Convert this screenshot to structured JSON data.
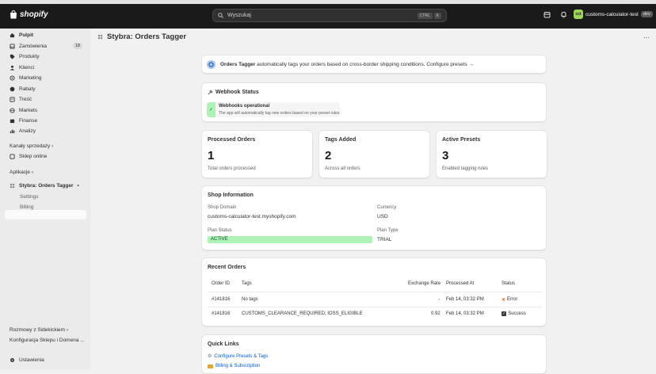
{
  "topbar": {
    "logo_text": "shopify",
    "search_placeholder": "Wyszukaj",
    "shortcut_keys": [
      "CTRL",
      "K"
    ],
    "store_avatar": "cct",
    "store_name": "customs-calculator-test",
    "store_badge": "dev"
  },
  "sidebar": {
    "items": [
      {
        "label": "Pulpit",
        "icon": "home-icon"
      },
      {
        "label": "Zamówienia",
        "icon": "inbox-icon",
        "badge": "18"
      },
      {
        "label": "Produkty",
        "icon": "tag-icon"
      },
      {
        "label": "Klienci",
        "icon": "person-icon"
      },
      {
        "label": "Marketing",
        "icon": "target-icon"
      },
      {
        "label": "Rabaty",
        "icon": "discount-icon"
      },
      {
        "label": "Treść",
        "icon": "content-icon"
      },
      {
        "label": "Markets",
        "icon": "globe-icon"
      },
      {
        "label": "Finanse",
        "icon": "bank-icon"
      },
      {
        "label": "Analizy",
        "icon": "chart-icon"
      }
    ],
    "sales_channels_label": "Kanały sprzedaży ›",
    "online_store_label": "Sklep online",
    "apps_label": "Aplikacje ›",
    "active_app_label": "Stybra: Orders Tagger",
    "app_sub_items": [
      "Settings",
      "Billing"
    ],
    "bottom_items": [
      "Rozmowy z Sidekickiem ›",
      "Konfiguracja Sklepu i Domena ..."
    ],
    "settings_label": "Ustawienia"
  },
  "page": {
    "title": "Stybra: Orders Tagger"
  },
  "banner": {
    "bold": "Orders Tagger",
    "text": "automatically tags your orders based on cross-border shipping conditions. Configure presets →"
  },
  "webhook": {
    "title": "Webhook Status",
    "status": "Webhooks operational",
    "description": "The app will automatically tag new orders based on your preset rules."
  },
  "stats": [
    {
      "label": "Processed Orders",
      "value": "1",
      "sub": "Total orders processed"
    },
    {
      "label": "Tags Added",
      "value": "2",
      "sub": "Across all orders"
    },
    {
      "label": "Active Presets",
      "value": "3",
      "sub": "Enabled tagging rules"
    }
  ],
  "shop_info": {
    "title": "Shop Information",
    "domain_label": "Shop Domain",
    "domain_value": "customs-calculator-test.myshopify.com",
    "currency_label": "Currency",
    "currency_value": "USD",
    "plan_status_label": "Plan Status",
    "plan_status_value": "ACTIVE",
    "plan_type_label": "Plan Type",
    "plan_type_value": "TRIAL"
  },
  "recent_orders": {
    "title": "Recent Orders",
    "headers": [
      "Order ID",
      "Tags",
      "Exchange Rate",
      "Processed At",
      "Status"
    ],
    "rows": [
      {
        "id": "#141816",
        "tags": "No tags",
        "rate": "-",
        "processed": "Feb 14, 03:32 PM",
        "status": "Error",
        "status_icon": "cross-icon"
      },
      {
        "id": "#141816",
        "tags": "CUSTOMS_CLEARANCE_REQUIRED, IOSS_ELIGIBLE",
        "rate": "0.92",
        "processed": "Feb 14, 03:32 PM",
        "status": "Success",
        "status_icon": "check-icon"
      }
    ]
  },
  "quick_links": {
    "title": "Quick Links",
    "items": [
      {
        "label": "Configure Presets & Tags",
        "icon": "gear-icon"
      },
      {
        "label": "Billing & Subscription",
        "icon": "card-icon"
      }
    ]
  },
  "colors": {
    "topbar": "#1a1a1a",
    "success_bg": "#aef2b5",
    "link": "#005bd3",
    "avatar": "#9ed35a"
  }
}
